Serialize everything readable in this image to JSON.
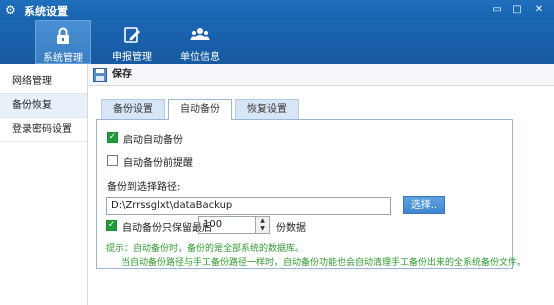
{
  "window": {
    "title": "系统设置",
    "buttons": [
      "minimize-icon",
      "maximize-icon",
      "close-icon"
    ]
  },
  "toolbar": {
    "items": [
      {
        "label": "系统管理",
        "icon": "lock-icon",
        "active": true
      },
      {
        "label": "申报管理",
        "icon": "edit-icon",
        "active": false
      },
      {
        "label": "单位信息",
        "icon": "users-icon",
        "active": false
      }
    ]
  },
  "sidebar": {
    "items": [
      {
        "label": "网络管理",
        "active": false
      },
      {
        "label": "备份恢复",
        "active": true
      },
      {
        "label": "登录密码设置",
        "active": false
      }
    ]
  },
  "actionbar": {
    "save_label": "保存",
    "save_icon": "save-icon"
  },
  "tabs": [
    {
      "label": "备份设置",
      "active": false
    },
    {
      "label": "自动备份",
      "active": true
    },
    {
      "label": "恢复设置",
      "active": false
    }
  ],
  "auto_backup": {
    "enable_label": "启动自动备份",
    "enable_checked": true,
    "remind_label": "自动备份前提醒",
    "remind_checked": false,
    "path_label": "备份到选择路径:",
    "path_value": "D:\\Zrrssglxt\\dataBackup",
    "browse_label": "选择..",
    "keep_label": "自动备份只保留最后",
    "keep_checked": true,
    "keep_value": "100",
    "keep_unit": "份数据",
    "tip_line1": "提示：自动备份时，备份的是全部系统的数据库。",
    "tip_line2": "当自动备份路径与手工备份路径一样时，自动备份功能也会自动清理手工备份出来的全系统备份文件。"
  },
  "colors": {
    "accent": "#1763ad",
    "tip_green": "#2f9a2f",
    "check_green": "#1e9a3a"
  }
}
